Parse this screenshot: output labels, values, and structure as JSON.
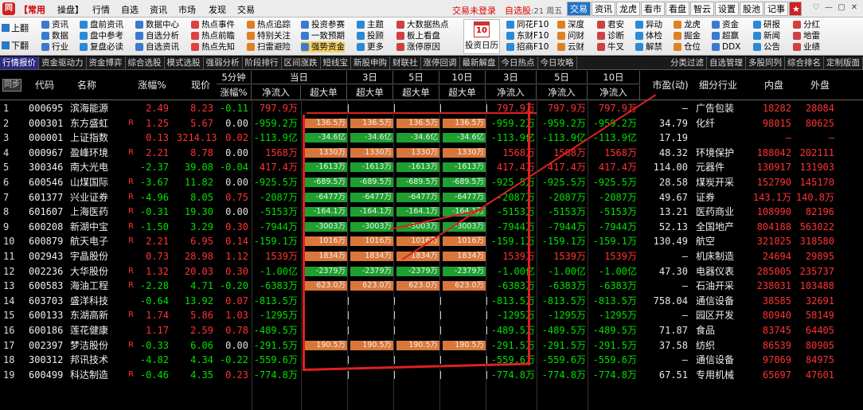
{
  "titlebar": {
    "menus": [
      "【常用",
      "操盘】",
      "行情",
      "自选",
      "资讯",
      "市场",
      "发现",
      "交易"
    ],
    "login": "交易未登录",
    "news": "自选股",
    "clock": ":21 周五",
    "quick_tabs": [
      "交易",
      "资讯",
      "龙虎",
      "看市",
      "看盘",
      "智云",
      "设置",
      "股池",
      "记事",
      "★"
    ],
    "win_controls": [
      "♡",
      "—",
      "▢",
      "✕"
    ]
  },
  "toolbar": {
    "page_up": "上翻",
    "page_down": "下翻",
    "col1": [
      "资讯",
      "数据",
      "行业"
    ],
    "col2": [
      "盘前资讯",
      "盘中参考",
      "复盘必读"
    ],
    "col3": [
      "数据中心",
      "自选分析",
      "自选资讯"
    ],
    "col4": [
      "热点事件",
      "热点前瞻",
      "热点先知"
    ],
    "col5": [
      "热点追踪",
      "特别关注",
      "扫雷避险"
    ],
    "col6": [
      "投资参赛",
      "一致预期",
      "强势资金"
    ],
    "col7": [
      "主题",
      "投顾",
      "更多"
    ],
    "col8": [
      "大数据热点",
      "板上看盘",
      "涨停原因"
    ],
    "calendar_label": "投资日历",
    "calendar_num": "10",
    "col9": [
      "同花F10",
      "东财F10",
      "招商F10"
    ],
    "col10": [
      "深度",
      "问财",
      "云财"
    ],
    "col11": [
      "君安",
      "诊断",
      "牛叉"
    ],
    "col12": [
      "异动",
      "体检",
      "解禁"
    ],
    "col13": [
      "龙虎",
      "掘金",
      "仓位"
    ],
    "col14": [
      "资金",
      "超赢",
      "DDX"
    ],
    "col15": [
      "研报",
      "新闻",
      "公告"
    ],
    "col16": [
      "分红",
      "地雷",
      "业绩"
    ]
  },
  "tabs": [
    "行情报价",
    "资金驱动力",
    "资金博弈",
    "综合选股",
    "模式选股",
    "强弱分析",
    "阶段排行",
    "区间涨跌",
    "短线宝",
    "新股申购",
    "财联社",
    "涨停回调",
    "最新解盘",
    "今日热点",
    "今日攻略",
    "分类过滤",
    "自选管理",
    "多股同列",
    "综合排名",
    "定制版面"
  ],
  "header": {
    "sync": "同步",
    "code": "代码",
    "name": "名称",
    "change_pct": "涨幅%",
    "price": "现价",
    "min5_top": "5分钟",
    "min5_bottom": "涨幅%",
    "today_top": "当日",
    "day3_top": "3日",
    "day5_top": "5日",
    "day10_top": "10日",
    "net_inflow": "净流入",
    "super_big": "超大单",
    "day3b_top": "3日",
    "day5b_top": "5日",
    "day10b_top": "10日",
    "pe": "市盈(动)",
    "industry": "细分行业",
    "inner": "内盘",
    "outer": "外盘"
  },
  "rows": [
    {
      "no": "1",
      "code": "000695",
      "name": "滨海能源",
      "r": "",
      "chg": "2.49",
      "price": "8.23",
      "m5": "-0.11",
      "net": "797.9万",
      "sb": [
        "",
        "",
        "",
        ""
      ],
      "sbv": [
        0,
        0,
        0,
        0
      ],
      "n3": "797.9万",
      "n5": "797.9万",
      "n10": "797.9万",
      "pe": "–",
      "ind": "广告包装",
      "inner": "18282",
      "outer": "28084"
    },
    {
      "no": "2",
      "code": "000301",
      "name": "东方盛虹",
      "r": "R",
      "chg": "1.25",
      "price": "5.67",
      "m5": "0.00",
      "net": "-959.2万",
      "sb": [
        "136.5万",
        "136.5万",
        "136.5万",
        "136.5万"
      ],
      "sbv": [
        1,
        1,
        1,
        1
      ],
      "n3": "-959.2万",
      "n5": "-959.2万",
      "n10": "-959.2万",
      "pe": "34.79",
      "ind": "化纤",
      "inner": "98015",
      "outer": "80625"
    },
    {
      "no": "3",
      "code": "000001",
      "name": "上证指数",
      "r": "",
      "chg": "0.13",
      "price": "3214.13",
      "m5": "0.02",
      "net": "-113.9亿",
      "sb": [
        "-34.6亿",
        "-34.6亿",
        "-34.6亿",
        "-34.6亿"
      ],
      "sbv": [
        -1,
        -1,
        -1,
        -1
      ],
      "n3": "-113.9亿",
      "n5": "-113.9亿",
      "n10": "-113.9亿",
      "pe": "17.19",
      "ind": "",
      "inner": "–",
      "outer": "–"
    },
    {
      "no": "4",
      "code": "000967",
      "name": "盈峰环境",
      "r": "R",
      "chg": "2.21",
      "price": "8.78",
      "m5": "0.00",
      "net": "1568万",
      "sb": [
        "1330万",
        "1330万",
        "1330万",
        "1330万"
      ],
      "sbv": [
        1,
        1,
        1,
        1
      ],
      "n3": "1568万",
      "n5": "1568万",
      "n10": "1568万",
      "pe": "48.32",
      "ind": "环境保护",
      "inner": "188042",
      "outer": "202111"
    },
    {
      "no": "5",
      "code": "300346",
      "name": "南大光电",
      "r": "",
      "chg": "-2.37",
      "price": "39.08",
      "m5": "-0.04",
      "net": "417.4万",
      "sb": [
        "-1613万",
        "-1613万",
        "-1613万",
        "-1613万"
      ],
      "sbv": [
        -1,
        -1,
        -1,
        -1
      ],
      "n3": "417.4万",
      "n5": "417.4万",
      "n10": "417.4万",
      "pe": "114.00",
      "ind": "元器件",
      "inner": "130917",
      "outer": "131903"
    },
    {
      "no": "6",
      "code": "600546",
      "name": "山煤国际",
      "r": "R",
      "chg": "-3.67",
      "price": "11.82",
      "m5": "0.00",
      "net": "-925.5万",
      "sb": [
        "-689.5万",
        "-689.5万",
        "-689.5万",
        "-689.5万"
      ],
      "sbv": [
        -1,
        -1,
        -1,
        -1
      ],
      "n3": "-925.5万",
      "n5": "-925.5万",
      "n10": "-925.5万",
      "pe": "28.58",
      "ind": "煤炭开采",
      "inner": "152790",
      "outer": "145170"
    },
    {
      "no": "7",
      "code": "601377",
      "name": "兴业证券",
      "r": "R",
      "chg": "-4.96",
      "price": "8.05",
      "m5": "0.75",
      "net": "-2087万",
      "sb": [
        "-6477万",
        "-6477万",
        "-6477万",
        "-6477万"
      ],
      "sbv": [
        -1,
        -1,
        -1,
        -1
      ],
      "n3": "-2087万",
      "n5": "-2087万",
      "n10": "-2087万",
      "pe": "49.67",
      "ind": "证券",
      "inner": "143.1万",
      "outer": "140.8万"
    },
    {
      "no": "8",
      "code": "601607",
      "name": "上海医药",
      "r": "R",
      "chg": "-0.31",
      "price": "19.30",
      "m5": "0.00",
      "net": "-5153万",
      "sb": [
        "-164.1万",
        "-164.1万",
        "-164.1万",
        "-164.1万"
      ],
      "sbv": [
        -1,
        -1,
        -1,
        -1
      ],
      "n3": "-5153万",
      "n5": "-5153万",
      "n10": "-5153万",
      "pe": "13.21",
      "ind": "医药商业",
      "inner": "108990",
      "outer": "82196"
    },
    {
      "no": "9",
      "code": "600208",
      "name": "新湖中宝",
      "r": "R",
      "chg": "-1.50",
      "price": "3.29",
      "m5": "0.30",
      "net": "-7944万",
      "sb": [
        "-3003万",
        "-3003万",
        "-3003万",
        "-3003万"
      ],
      "sbv": [
        -1,
        -1,
        -1,
        -1
      ],
      "n3": "-7944万",
      "n5": "-7944万",
      "n10": "-7944万",
      "pe": "52.13",
      "ind": "全国地产",
      "inner": "804188",
      "outer": "563022"
    },
    {
      "no": "10",
      "code": "600879",
      "name": "航天电子",
      "r": "R",
      "chg": "2.21",
      "price": "6.95",
      "m5": "0.14",
      "net": "-159.1万",
      "sb": [
        "1016万",
        "1016万",
        "1016万",
        "1016万"
      ],
      "sbv": [
        1,
        1,
        1,
        1
      ],
      "n3": "-159.1万",
      "n5": "-159.1万",
      "n10": "-159.1万",
      "pe": "130.49",
      "ind": "航空",
      "inner": "321025",
      "outer": "318580"
    },
    {
      "no": "11",
      "code": "002943",
      "name": "宇晶股份",
      "r": "",
      "chg": "0.73",
      "price": "28.98",
      "m5": "1.12",
      "net": "1539万",
      "sb": [
        "1834万",
        "1834万",
        "1834万",
        "1834万"
      ],
      "sbv": [
        1,
        1,
        1,
        1
      ],
      "n3": "1539万",
      "n5": "1539万",
      "n10": "1539万",
      "pe": "–",
      "ind": "机床制造",
      "inner": "24694",
      "outer": "29895"
    },
    {
      "no": "12",
      "code": "002236",
      "name": "大华股份",
      "r": "R",
      "chg": "1.32",
      "price": "20.03",
      "m5": "0.30",
      "net": "-1.00亿",
      "sb": [
        "-2379万",
        "-2379万",
        "-2379万",
        "-2379万"
      ],
      "sbv": [
        -1,
        -1,
        -1,
        -1
      ],
      "n3": "-1.00亿",
      "n5": "-1.00亿",
      "n10": "-1.00亿",
      "pe": "47.30",
      "ind": "电器仪表",
      "inner": "285005",
      "outer": "235737"
    },
    {
      "no": "13",
      "code": "600583",
      "name": "海油工程",
      "r": "R",
      "chg": "-2.28",
      "price": "4.71",
      "m5": "-0.20",
      "net": "-6383万",
      "sb": [
        "623.0万",
        "623.0万",
        "623.0万",
        "623.0万"
      ],
      "sbv": [
        1,
        1,
        1,
        1
      ],
      "n3": "-6383万",
      "n5": "-6383万",
      "n10": "-6383万",
      "pe": "–",
      "ind": "石油开采",
      "inner": "238031",
      "outer": "103488"
    },
    {
      "no": "14",
      "code": "603703",
      "name": "盛洋科技",
      "r": "",
      "chg": "-0.64",
      "price": "13.92",
      "m5": "0.07",
      "net": "-813.5万",
      "sb": [
        "",
        "",
        "",
        ""
      ],
      "sbv": [
        0,
        0,
        0,
        0
      ],
      "n3": "-813.5万",
      "n5": "-813.5万",
      "n10": "-813.5万",
      "pe": "758.04",
      "ind": "通信设备",
      "inner": "38585",
      "outer": "32691"
    },
    {
      "no": "15",
      "code": "600133",
      "name": "东湖高新",
      "r": "R",
      "chg": "1.74",
      "price": "5.86",
      "m5": "1.03",
      "net": "-1295万",
      "sb": [
        "",
        "",
        "",
        ""
      ],
      "sbv": [
        0,
        0,
        0,
        0
      ],
      "n3": "-1295万",
      "n5": "-1295万",
      "n10": "-1295万",
      "pe": "–",
      "ind": "园区开发",
      "inner": "80940",
      "outer": "58149"
    },
    {
      "no": "16",
      "code": "600186",
      "name": "莲花健康",
      "r": "",
      "chg": "1.17",
      "price": "2.59",
      "m5": "0.78",
      "net": "-489.5万",
      "sb": [
        "",
        "",
        "",
        ""
      ],
      "sbv": [
        0,
        0,
        0,
        0
      ],
      "n3": "-489.5万",
      "n5": "-489.5万",
      "n10": "-489.5万",
      "pe": "71.87",
      "ind": "食品",
      "inner": "83745",
      "outer": "64405"
    },
    {
      "no": "17",
      "code": "002397",
      "name": "梦洁股份",
      "r": "R",
      "chg": "-0.33",
      "price": "6.06",
      "m5": "0.00",
      "net": "-291.5万",
      "sb": [
        "190.5万",
        "190.5万",
        "190.5万",
        "190.5万"
      ],
      "sbv": [
        1,
        1,
        1,
        1
      ],
      "n3": "-291.5万",
      "n5": "-291.5万",
      "n10": "-291.5万",
      "pe": "37.58",
      "ind": "纺织",
      "inner": "86539",
      "outer": "80905"
    },
    {
      "no": "18",
      "code": "300312",
      "name": "邦讯技术",
      "r": "",
      "chg": "-4.82",
      "price": "4.34",
      "m5": "-0.22",
      "net": "-559.6万",
      "sb": [
        "",
        "",
        "",
        ""
      ],
      "sbv": [
        0,
        0,
        0,
        0
      ],
      "n3": "-559.6万",
      "n5": "-559.6万",
      "n10": "-559.6万",
      "pe": "–",
      "ind": "通信设备",
      "inner": "97069",
      "outer": "84975"
    },
    {
      "no": "19",
      "code": "600499",
      "name": "科达制造",
      "r": "R",
      "chg": "-0.46",
      "price": "4.35",
      "m5": "0.23",
      "net": "-774.8万",
      "sb": [
        "",
        "",
        "",
        ""
      ],
      "sbv": [
        0,
        0,
        0,
        0
      ],
      "n3": "-774.8万",
      "n5": "-774.8万",
      "n10": "-774.8万",
      "pe": "67.51",
      "ind": "专用机械",
      "inner": "65697",
      "outer": "47601"
    }
  ],
  "colors": {
    "up": "#ff3232",
    "down": "#00e000",
    "annotation": "#e02020",
    "bar_pos": "#d9773a",
    "bar_neg": "#1ea030"
  }
}
